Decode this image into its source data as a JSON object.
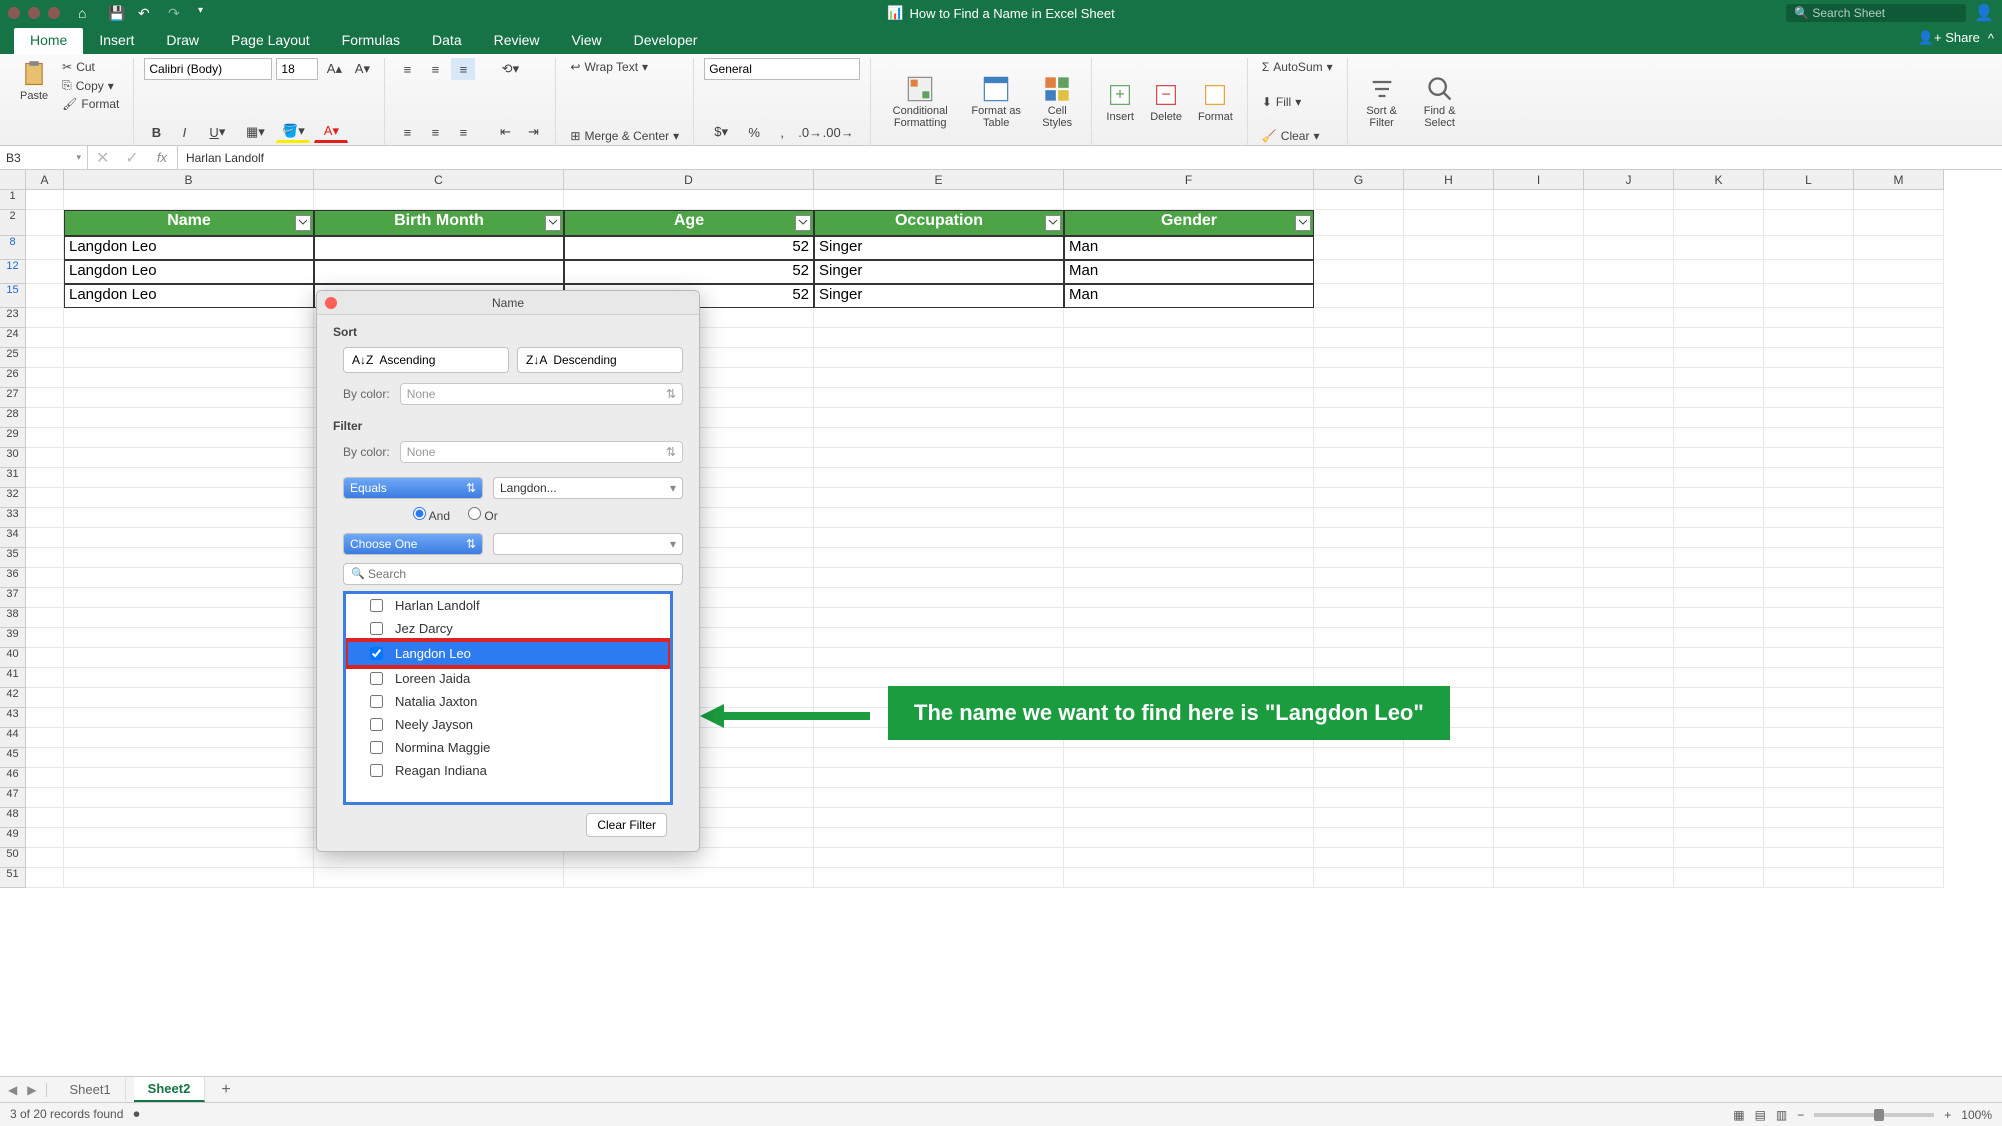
{
  "app": {
    "title": "How to Find a Name in Excel Sheet",
    "search_placeholder": "Search Sheet",
    "share": "Share"
  },
  "tabs": {
    "home": "Home",
    "insert": "Insert",
    "draw": "Draw",
    "pagelayout": "Page Layout",
    "formulas": "Formulas",
    "data": "Data",
    "review": "Review",
    "view": "View",
    "developer": "Developer"
  },
  "ribbon": {
    "paste": "Paste",
    "cut": "Cut",
    "copy": "Copy",
    "format": "Format",
    "font": "Calibri (Body)",
    "size": "18",
    "wrap": "Wrap Text",
    "merge": "Merge & Center",
    "number_format": "General",
    "cond_fmt": "Conditional Formatting",
    "as_table": "Format as Table",
    "cell_styles": "Cell Styles",
    "insert_btn": "Insert",
    "delete_btn": "Delete",
    "format_btn": "Format",
    "autosum": "AutoSum",
    "fill": "Fill",
    "clear": "Clear",
    "sort_filter": "Sort & Filter",
    "find_select": "Find & Select"
  },
  "fbar": {
    "cellref": "B3",
    "formula": "Harlan Landolf"
  },
  "columns": [
    "A",
    "B",
    "C",
    "D",
    "E",
    "F",
    "G",
    "H",
    "I",
    "J",
    "K",
    "L",
    "M"
  ],
  "table": {
    "headers": {
      "name": "Name",
      "birth": "Birth Month",
      "age": "Age",
      "occ": "Occupation",
      "gender": "Gender"
    },
    "rows": [
      {
        "rn": "8",
        "name": "Langdon Leo",
        "age": "52",
        "occ": "Singer",
        "gender": "Man"
      },
      {
        "rn": "12",
        "name": "Langdon Leo",
        "age": "52",
        "occ": "Singer",
        "gender": "Man"
      },
      {
        "rn": "15",
        "name": "Langdon Leo",
        "age": "52",
        "occ": "Singer",
        "gender": "Man"
      }
    ],
    "remaining_rows": [
      "23",
      "24",
      "25",
      "26",
      "27",
      "28",
      "29",
      "30",
      "31",
      "32",
      "33",
      "34",
      "35",
      "36",
      "37",
      "38",
      "39",
      "40",
      "41",
      "42",
      "43",
      "44",
      "45",
      "46",
      "47",
      "48",
      "49",
      "50",
      "51"
    ]
  },
  "filter_dlg": {
    "title": "Name",
    "sort": "Sort",
    "asc": "Ascending",
    "desc": "Descending",
    "bycolor": "By color:",
    "none": "None",
    "filter": "Filter",
    "equals": "Equals",
    "langdon": "Langdon...",
    "and": "And",
    "or": "Or",
    "choose": "Choose One",
    "search_ph": "Search",
    "items": [
      "Harlan Landolf",
      "Jez Darcy",
      "Langdon Leo",
      "Loreen Jaida",
      "Natalia Jaxton",
      "Neely Jayson",
      "Normina Maggie",
      "Reagan Indiana"
    ],
    "clear": "Clear Filter"
  },
  "annotation": "The name we want to find here is \"Langdon Leo\"",
  "sheets": {
    "s1": "Sheet1",
    "s2": "Sheet2"
  },
  "status": {
    "records": "3 of 20 records found",
    "zoom": "100%"
  }
}
